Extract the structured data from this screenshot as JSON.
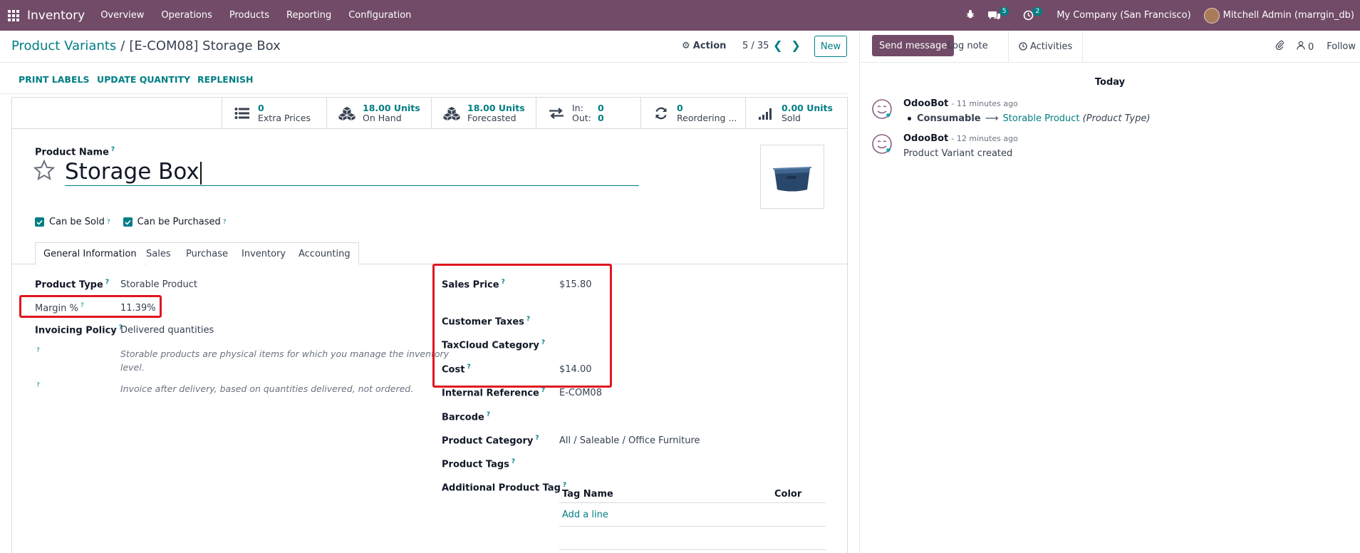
{
  "navbar": {
    "app_name": "Inventory",
    "menus": [
      "Overview",
      "Operations",
      "Products",
      "Reporting",
      "Configuration"
    ],
    "messages_count": "5",
    "activities_count": "2",
    "company": "My Company (San Francisco)",
    "user": "Mitchell Admin (marrgin_db)"
  },
  "control": {
    "breadcrumb_parent": "Product Variants",
    "breadcrumb_sep": "/",
    "breadcrumb_current": "[E-COM08] Storage Box",
    "action_label": "Action",
    "pager": "5 / 35",
    "new_label": "New"
  },
  "statusbar": {
    "print_labels": "PRINT LABELS",
    "update_quantity": "UPDATE QUANTITY",
    "replenish": "REPLENISH"
  },
  "stats": {
    "extra_prices": {
      "value": "0",
      "label": "Extra Prices"
    },
    "on_hand": {
      "value": "18.00 Units",
      "label": "On Hand"
    },
    "forecasted": {
      "value": "18.00 Units",
      "label": "Forecasted"
    },
    "inout": {
      "in_label": "In:",
      "in_value": "0",
      "out_label": "Out:",
      "out_value": "0"
    },
    "reordering": {
      "value": "0",
      "label": "Reordering ..."
    },
    "sold": {
      "value": "0.00 Units",
      "label": "Sold"
    }
  },
  "product": {
    "name_label": "Product Name",
    "name": "Storage Box",
    "can_be_sold": "Can be Sold",
    "can_be_purchased": "Can be Purchased"
  },
  "tabs": [
    "General Information",
    "Sales",
    "Purchase",
    "Inventory",
    "Accounting"
  ],
  "left_fields": {
    "product_type_label": "Product Type",
    "product_type": "Storable Product",
    "margin_label": "Margin %",
    "margin": "11.39%",
    "invoicing_label": "Invoicing Policy",
    "invoicing": "Delivered quantities",
    "note_storable_1": "Storable products are physical items for which you manage the inventory",
    "note_storable_2": "level.",
    "note_invoice": "Invoice after delivery, based on quantities delivered, not ordered."
  },
  "right_fields": {
    "sales_price_label": "Sales Price",
    "sales_price": "$15.80",
    "customer_taxes_label": "Customer Taxes",
    "taxcloud_label": "TaxCloud Category",
    "cost_label": "Cost",
    "cost": "$14.00",
    "internal_ref_label": "Internal Reference",
    "internal_ref": "E-COM08",
    "barcode_label": "Barcode",
    "category_label": "Product Category",
    "category": "All / Saleable / Office Furniture",
    "tags_label": "Product Tags",
    "additional_tag_label": "Additional Product Tag",
    "tag_col_name": "Tag Name",
    "tag_col_color": "Color",
    "add_line": "Add a line"
  },
  "chatter": {
    "send_message": "Send message",
    "log_note": "Log note",
    "activities": "Activities",
    "followers_count": "0",
    "follow": "Follow",
    "date_header": "Today",
    "messages": [
      {
        "author": "OdooBot",
        "time": "- 11 minutes ago",
        "old": "Consumable",
        "new": "Storable Product",
        "field": "(Product Type)"
      },
      {
        "author": "OdooBot",
        "time": "- 12 minutes ago",
        "body": "Product Variant created"
      }
    ]
  },
  "colors": {
    "brand": "#714B67",
    "accent": "#017e84",
    "highlight": "#e0171f"
  }
}
